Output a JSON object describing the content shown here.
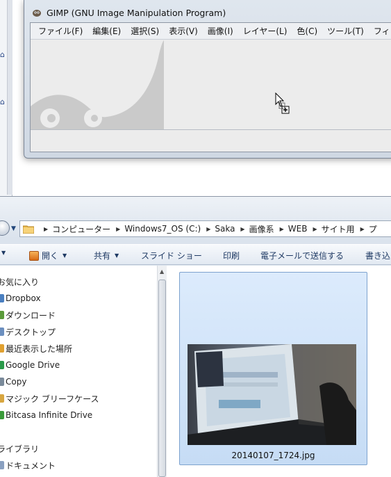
{
  "gimp": {
    "title": "GIMP (GNU Image Manipulation Program)",
    "menu": [
      "ファイル(F)",
      "編集(E)",
      "選択(S)",
      "表示(V)",
      "画像(I)",
      "レイヤー(L)",
      "色(C)",
      "ツール(T)",
      "フィ"
    ]
  },
  "explorer": {
    "breadcrumb": [
      "コンピューター",
      "Windows7_OS (C:)",
      "Saka",
      "画像系",
      "WEB",
      "サイト用",
      "プ"
    ],
    "commands": {
      "open": "開く",
      "share": "共有",
      "slideshow": "スライド ショー",
      "print": "印刷",
      "email": "電子メールで送信する",
      "burn": "書き込"
    },
    "nav": {
      "favorites": "お気に入り",
      "items": [
        "Dropbox",
        "ダウンロード",
        "デスクトップ",
        "最近表示した場所",
        "Google Drive",
        "Copy",
        "マジック ブリーフケース",
        "Bitcasa Infinite Drive"
      ],
      "libraries": "ライブラリ",
      "library_items": [
        "ドキュメント"
      ]
    },
    "file": {
      "name": "20140107_1724.jpg"
    }
  },
  "colors": {
    "accent": "#1e3963",
    "selection": "#cfe2f8",
    "gimp_watermark": "#c9c9c9",
    "nav_icons": [
      "#4a7fc0",
      "#5a9a3a",
      "#6c8fbf",
      "#e0a030",
      "#2a9a4a",
      "#7a8a9a",
      "#d8a640",
      "#3a9a3a"
    ]
  }
}
